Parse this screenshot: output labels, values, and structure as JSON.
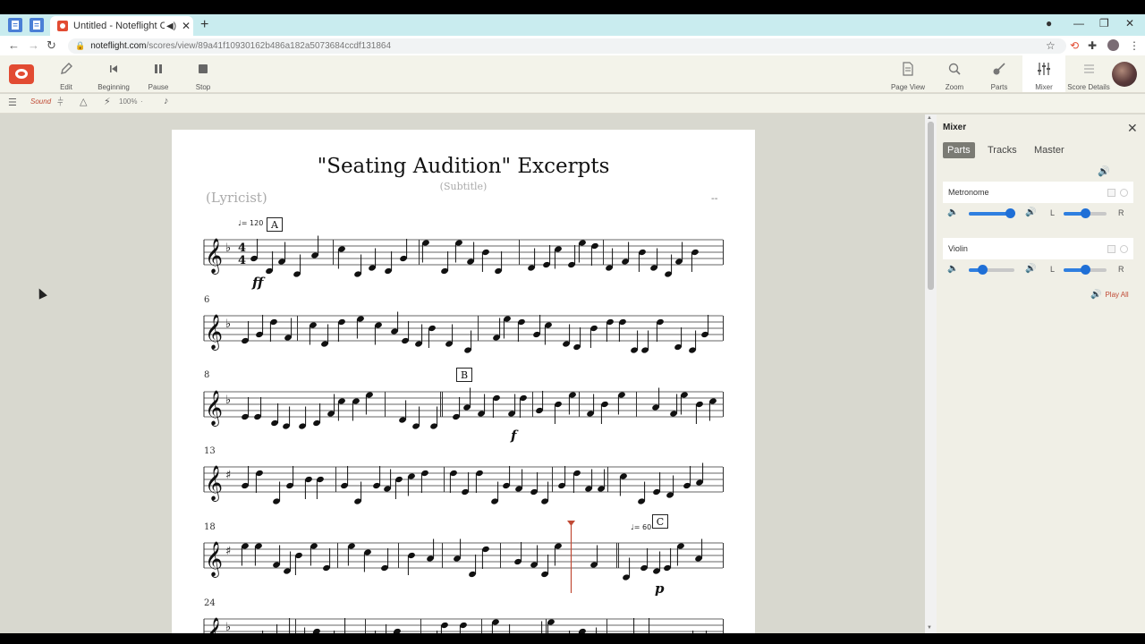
{
  "browser": {
    "tab_title": "Untitled - Noteflight Commu",
    "url_host": "noteflight.com",
    "url_path": "/scores/view/89a41f10930162b486a182a5073684ccdf131864"
  },
  "toolbar": {
    "edit": "Edit",
    "beginning": "Beginning",
    "pause": "Pause",
    "stop": "Stop",
    "page_view": "Page View",
    "zoom": "Zoom",
    "parts": "Parts",
    "mixer": "Mixer",
    "score_details": "Score Details"
  },
  "subtoolbar": {
    "sound": "Sound",
    "zoom_value": "100%"
  },
  "score": {
    "title": "\"Seating Audition\" Excerpts",
    "subtitle": "(Subtitle)",
    "lyricist": "(Lyricist)",
    "composer": "--",
    "measure_numbers": [
      "6",
      "8",
      "13",
      "18",
      "24"
    ],
    "rehearsal_marks": [
      "A",
      "B",
      "C"
    ],
    "tempo_1": "= 120",
    "tempo_2": "= 60",
    "dynamics": [
      "ff",
      "f",
      "p"
    ]
  },
  "mixer": {
    "title": "Mixer",
    "tabs": [
      "Parts",
      "Tracks",
      "Master"
    ],
    "active_tab": "Parts",
    "parts": [
      {
        "name": "Metronome",
        "volume": 0.9,
        "pan": 0.5
      },
      {
        "name": "Violin",
        "volume": 0.3,
        "pan": 0.5
      }
    ],
    "pan_left": "L",
    "pan_right": "R",
    "play_all": "Play All"
  },
  "colors": {
    "accent": "#e24b32",
    "slider": "#2f7fe0",
    "playhead": "#c04a35"
  }
}
